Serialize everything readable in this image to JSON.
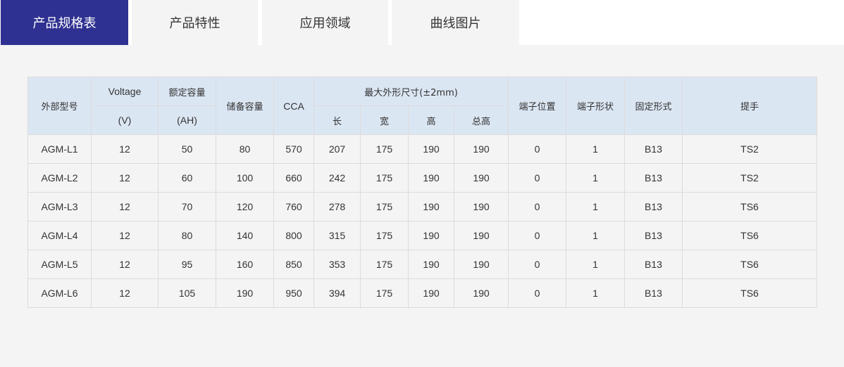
{
  "tabs": [
    {
      "label": "产品规格表",
      "active": true
    },
    {
      "label": "产品特性",
      "active": false
    },
    {
      "label": "应用领域",
      "active": false
    },
    {
      "label": "曲线图片",
      "active": false
    }
  ],
  "colors": {
    "active_tab": "#2e3191",
    "header_bg": "#dbe6f3",
    "panel_bg": "#f4f4f4"
  },
  "table": {
    "headers": {
      "model": "外部型号",
      "voltage": "Voltage",
      "voltage_unit": "(V)",
      "capacity": "额定容量",
      "capacity_unit": "(AH)",
      "reserve": "储备容量",
      "cca": "CCA",
      "dimensions": "最大外形尺寸(±2mm)",
      "length": "长",
      "width": "宽",
      "height": "高",
      "total_height": "总高",
      "terminal_position": "端子位置",
      "terminal_shape": "端子形状",
      "mounting": "固定形式",
      "handle": "提手"
    },
    "rows": [
      [
        "AGM-L1",
        "12",
        "50",
        "80",
        "570",
        "207",
        "175",
        "190",
        "190",
        "0",
        "1",
        "B13",
        "TS2"
      ],
      [
        "AGM-L2",
        "12",
        "60",
        "100",
        "660",
        "242",
        "175",
        "190",
        "190",
        "0",
        "1",
        "B13",
        "TS2"
      ],
      [
        "AGM-L3",
        "12",
        "70",
        "120",
        "760",
        "278",
        "175",
        "190",
        "190",
        "0",
        "1",
        "B13",
        "TS6"
      ],
      [
        "AGM-L4",
        "12",
        "80",
        "140",
        "800",
        "315",
        "175",
        "190",
        "190",
        "0",
        "1",
        "B13",
        "TS6"
      ],
      [
        "AGM-L5",
        "12",
        "95",
        "160",
        "850",
        "353",
        "175",
        "190",
        "190",
        "0",
        "1",
        "B13",
        "TS6"
      ],
      [
        "AGM-L6",
        "12",
        "105",
        "190",
        "950",
        "394",
        "175",
        "190",
        "190",
        "0",
        "1",
        "B13",
        "TS6"
      ]
    ]
  }
}
